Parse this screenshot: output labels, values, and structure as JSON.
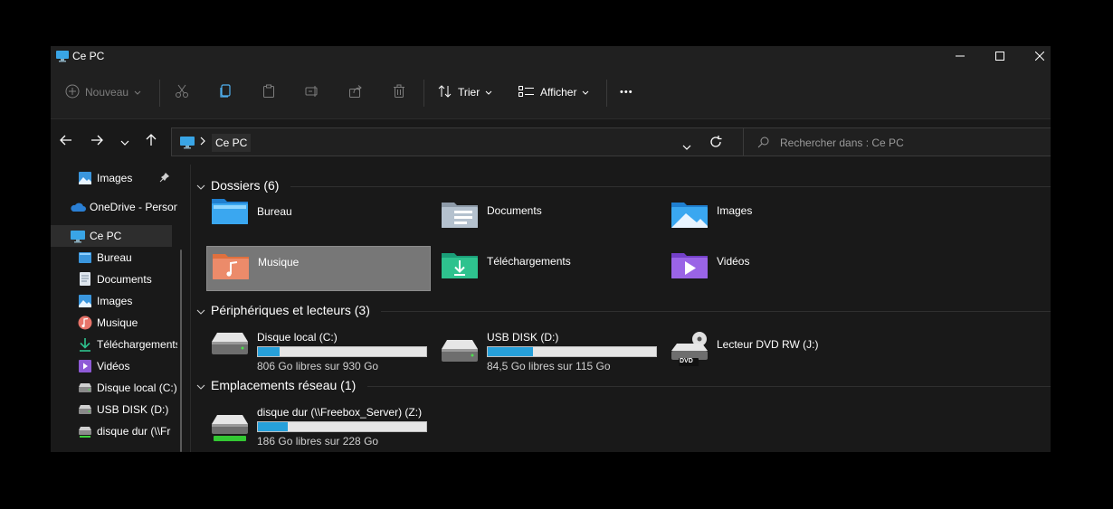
{
  "window": {
    "title": "Ce PC"
  },
  "toolbar": {
    "new_label": "Nouveau",
    "sort_label": "Trier",
    "view_label": "Afficher",
    "more_label": "•••"
  },
  "address": {
    "path": "Ce PC",
    "search_placeholder": "Rechercher dans : Ce PC"
  },
  "sidebar": {
    "items": [
      {
        "label": "Images",
        "icon": "images-icon",
        "pinned": true
      },
      {
        "label": "OneDrive - Person",
        "icon": "onedrive-icon"
      },
      {
        "label": "Ce PC",
        "icon": "pc-icon",
        "selected": true
      },
      {
        "label": "Bureau",
        "icon": "desktop-icon"
      },
      {
        "label": "Documents",
        "icon": "documents-icon"
      },
      {
        "label": "Images",
        "icon": "images-icon"
      },
      {
        "label": "Musique",
        "icon": "music-icon"
      },
      {
        "label": "Téléchargements",
        "icon": "downloads-icon"
      },
      {
        "label": "Vidéos",
        "icon": "videos-icon"
      },
      {
        "label": "Disque local (C:)",
        "icon": "drive-icon"
      },
      {
        "label": "USB DISK (D:)",
        "icon": "drive-icon"
      },
      {
        "label": "disque dur (\\\\Fr",
        "icon": "network-drive-icon"
      }
    ]
  },
  "groups": {
    "folders_title": "Dossiers (6)",
    "devices_title": "Périphériques et lecteurs (3)",
    "network_title": "Emplacements réseau (1)"
  },
  "folders": [
    {
      "label": "Bureau",
      "icon": "desktop-folder-icon"
    },
    {
      "label": "Documents",
      "icon": "documents-folder-icon"
    },
    {
      "label": "Images",
      "icon": "images-folder-icon"
    },
    {
      "label": "Musique",
      "icon": "music-folder-icon",
      "selected": true
    },
    {
      "label": "Téléchargements",
      "icon": "downloads-folder-icon"
    },
    {
      "label": "Vidéos",
      "icon": "videos-folder-icon"
    }
  ],
  "devices": [
    {
      "name": "Disque local (C:)",
      "free": "806 Go libres sur 930 Go",
      "used_fraction": 0.13
    },
    {
      "name": "USB DISK (D:)",
      "free": "84,5 Go libres sur 115 Go",
      "used_fraction": 0.27
    },
    {
      "name": "Lecteur DVD RW (J:)",
      "badge": "DVD"
    }
  ],
  "network": [
    {
      "name": "disque dur (\\\\Freebox_Server) (Z:)",
      "free": "186 Go libres sur 228 Go",
      "used_fraction": 0.18
    }
  ],
  "colors": {
    "accent": "#26a0da",
    "background": "#191919",
    "chrome": "#202020"
  }
}
